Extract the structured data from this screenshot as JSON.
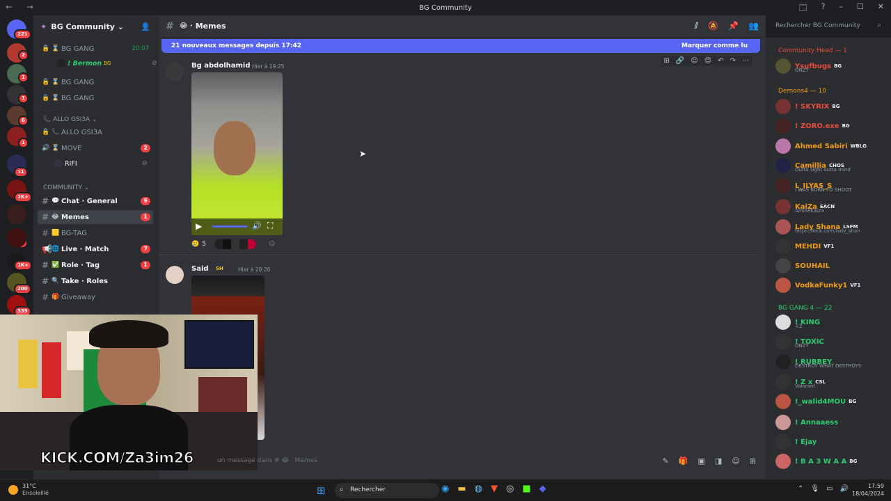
{
  "window": {
    "title": "BG Community",
    "nav_arrows": "← →",
    "controls": [
      "🗔",
      "?",
      "–",
      "☐",
      "✕"
    ]
  },
  "servers": {
    "badges": [
      "221",
      "2",
      "1",
      "1",
      "6",
      "1",
      "11",
      "1K+",
      "14",
      "1K+",
      "200",
      "339"
    ]
  },
  "guild": {
    "name": "BG Community ⌄",
    "channels": {
      "vc1": {
        "label": "BG GANG",
        "time": "20:07"
      },
      "voice_user": {
        "name": "! Bermon",
        "tag": "BG"
      },
      "vc2": {
        "label": "BG GANG"
      },
      "vc3": {
        "label": "BG GANG"
      },
      "allo_cat": "ALLO GSI3A ⌄",
      "allo": {
        "label": "ALLO GSI3A"
      },
      "move": {
        "label": "MOVE",
        "badge": "2"
      },
      "rifi": {
        "label": "RIFI"
      },
      "community_cat": "COMMUNITY ⌄",
      "general": {
        "label": "Chat · General",
        "badge": "9"
      },
      "memes": {
        "label": "Memes",
        "badge": "1"
      },
      "bgtag": {
        "label": "BG-TAG"
      },
      "live": {
        "label": "Live · Match",
        "badge": "7"
      },
      "role": {
        "label": "Role · Tag",
        "badge": "1"
      },
      "take": {
        "label": "Take · Roles"
      },
      "giveaway": {
        "label": "Giveaway"
      }
    }
  },
  "header": {
    "channel": "Memes",
    "search_placeholder": "Rechercher BG Community"
  },
  "new_messages": {
    "text": "21 nouveaux messages depuis 17:42",
    "mark_read": "Marquer comme lu"
  },
  "messages": [
    {
      "author": "Bg abdolhamid",
      "time": "Hier à 19:25",
      "reaction_count": "5"
    },
    {
      "author": "Said",
      "badge": "SH",
      "time": "Hier à 20:20"
    }
  ],
  "chat_input": {
    "placeholder": "un message dans # 😂 · Memes"
  },
  "members": {
    "group1": "Community Head — 1",
    "group2": "Demons4 — 10",
    "group3": "BG GANG 4 — 22",
    "list": [
      {
        "name": "Ysufbugs",
        "tag": "BG",
        "sub": "ONZY",
        "color": "#e74c3c"
      },
      {
        "name": "! SKYRIX",
        "tag": "BG",
        "sub": "",
        "color": "#e74c3c"
      },
      {
        "name": "! ZORO.exe",
        "tag": "BG",
        "sub": "",
        "color": "#e74c3c"
      },
      {
        "name": "Ahmed Sabiri",
        "tag": "WBLG",
        "sub": "",
        "color": "#f39c12"
      },
      {
        "name": "Camillia",
        "tag": "CHOS",
        "sub": "Outta sight outta mind",
        "color": "#f39c12"
      },
      {
        "name": "L_ILYAS_S",
        "tag": "",
        "sub": "I WAS BORN TO SHOOT",
        "color": "#f39c12"
      },
      {
        "name": "KaiZa",
        "tag": "EACN",
        "sub": "AmineKaiZa",
        "color": "#f39c12"
      },
      {
        "name": "Lady Shana",
        "tag": "LSFM",
        "sub": "https://kick.com/lady_shan",
        "color": "#f39c12"
      },
      {
        "name": "MEHDI",
        "tag": "VF1",
        "sub": "",
        "color": "#f39c12"
      },
      {
        "name": "SOUHAIL",
        "tag": "",
        "sub": "",
        "color": "#f39c12"
      },
      {
        "name": "VodkaFunky1",
        "tag": "VF1",
        "sub": "",
        "color": "#f39c12"
      },
      {
        "name": "! KING",
        "tag": "",
        "sub": "+2",
        "color": "#2ecc71"
      },
      {
        "name": "! TOXIC",
        "tag": "",
        "sub": "ONZY",
        "color": "#2ecc71"
      },
      {
        "name": "! RUBBEY",
        "tag": "",
        "sub": "DESTROY WHAT DESTROYS",
        "color": "#2ecc71"
      },
      {
        "name": "! Z x",
        "tag": "CSL",
        "sub": "Valorant",
        "color": "#2ecc71"
      },
      {
        "name": "!_walid4MOU",
        "tag": "BG",
        "sub": "",
        "color": "#2ecc71"
      },
      {
        "name": "! Annaaess",
        "tag": "",
        "sub": "",
        "color": "#2ecc71"
      },
      {
        "name": "! Ejay",
        "tag": "",
        "sub": "",
        "color": "#2ecc71"
      },
      {
        "name": "! B A 3 W A A",
        "tag": "BG",
        "sub": "",
        "color": "#2ecc71"
      }
    ]
  },
  "overlay": {
    "kick": "KICK.COM/Za3im26"
  },
  "taskbar": {
    "weather_temp": "31°C",
    "weather_text": "Ensoleillé",
    "search": "Rechercher",
    "time": "17:59",
    "date": "18/04/2024"
  },
  "colors": {
    "accent": "#5865f2",
    "badge": "#f23f43"
  }
}
